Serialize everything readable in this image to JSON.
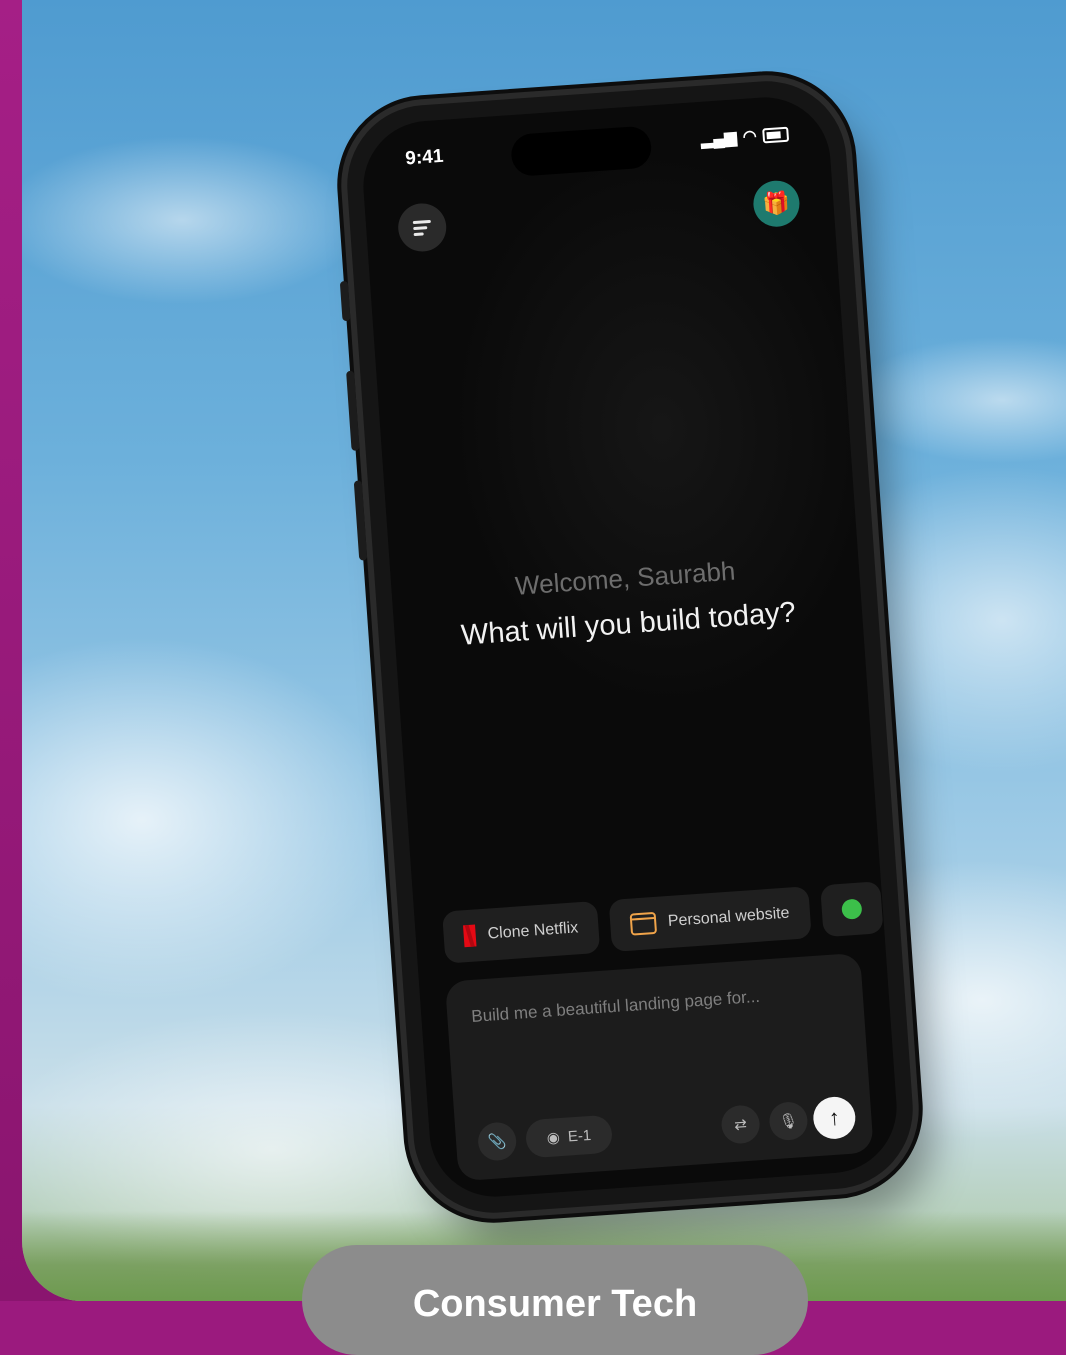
{
  "status_bar": {
    "time": "9:41"
  },
  "greeting": {
    "welcome": "Welcome, Saurabh",
    "headline": "What will you build today?"
  },
  "suggestions": [
    {
      "label": "Clone Netflix",
      "icon": "netflix-icon"
    },
    {
      "label": "Personal website",
      "icon": "website-icon"
    },
    {
      "label": "",
      "icon": "green-circle-icon"
    }
  ],
  "composer": {
    "placeholder": "Build me a beautiful landing page for...",
    "model_label": "E-1"
  },
  "caption": {
    "text": "Consumer Tech"
  },
  "colors": {
    "frame": "#9b1a7e",
    "accent_gift": "#1e7a6e",
    "sky": "#6cb0db"
  }
}
